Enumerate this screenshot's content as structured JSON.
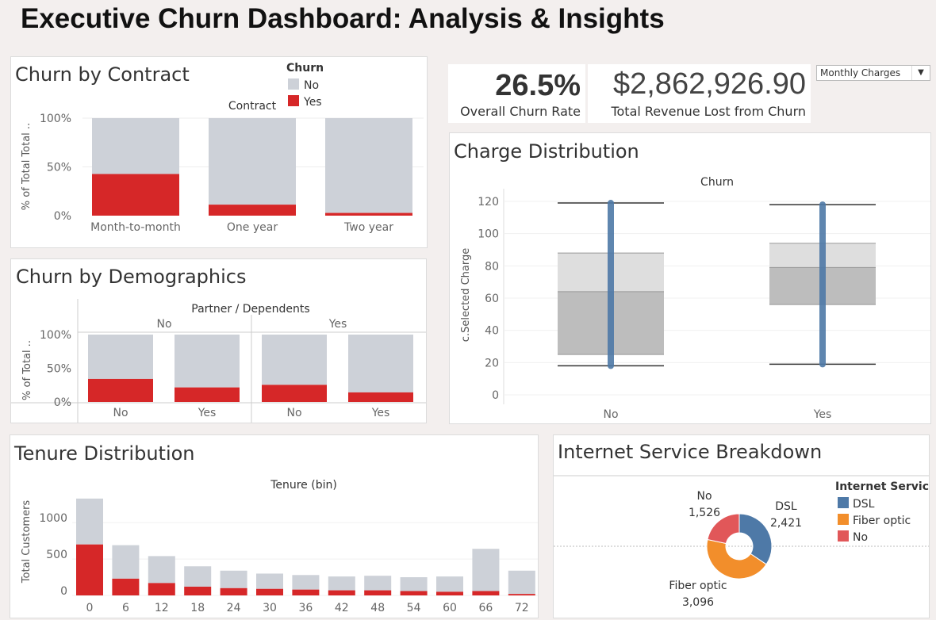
{
  "dashboard": {
    "title": "Executive Churn Dashboard: Analysis & Insights",
    "kpi_rate_value": "26.5%",
    "kpi_rate_label": "Overall Churn Rate",
    "kpi_revenue_value": "$2,862,926.90",
    "kpi_revenue_label": "Total Revenue Lost from Churn",
    "dropdown_value": "Monthly Charges"
  },
  "colors": {
    "no": "#cdd1d8",
    "yes": "#d62728",
    "box_dark": "#bdbdbd",
    "box_light": "#dedede",
    "strip": "#4e79a7",
    "dsl": "#4e79a7",
    "fiber": "#f28e2b",
    "none": "#e15759"
  },
  "chart_data": [
    {
      "id": "contract",
      "type": "bar",
      "title": "Churn by Contract",
      "header": "Contract",
      "ylabel": "% of Total Total ..",
      "legend_title": "Churn",
      "legend": [
        "No",
        "Yes"
      ],
      "categories": [
        "Month-to-month",
        "One year",
        "Two year"
      ],
      "yticks": [
        "100%",
        "50%",
        "0%"
      ],
      "ylim": [
        0,
        1
      ],
      "series": [
        {
          "name": "No",
          "values": [
            0.573,
            0.887,
            0.972
          ]
        },
        {
          "name": "Yes",
          "values": [
            0.427,
            0.113,
            0.028
          ]
        }
      ]
    },
    {
      "id": "demographics",
      "type": "bar",
      "title": "Churn by Demographics",
      "header": "Partner  /  Dependents",
      "ylabel": "% of Total ..",
      "groups": [
        "No",
        "Yes"
      ],
      "categories": [
        "No",
        "Yes",
        "No",
        "Yes"
      ],
      "yticks": [
        "100%",
        "50%",
        "0%"
      ],
      "ylim": [
        0,
        1
      ],
      "series": [
        {
          "name": "No",
          "values": [
            0.658,
            0.784,
            0.746,
            0.858
          ]
        },
        {
          "name": "Yes",
          "values": [
            0.342,
            0.216,
            0.254,
            0.142
          ]
        }
      ]
    },
    {
      "id": "charges",
      "type": "box",
      "title": "Charge Distribution",
      "header": "Churn",
      "ylabel": "c.Selected Charge",
      "categories": [
        "No",
        "Yes"
      ],
      "yticks": [
        0,
        20,
        40,
        60,
        80,
        100,
        120
      ],
      "ylim": [
        0,
        120
      ],
      "boxes": [
        {
          "name": "No",
          "min": 18,
          "q1": 25,
          "median": 64,
          "q3": 88,
          "max": 119
        },
        {
          "name": "Yes",
          "min": 19,
          "q1": 56,
          "median": 79,
          "q3": 94,
          "max": 118
        }
      ]
    },
    {
      "id": "tenure",
      "type": "bar",
      "title": "Tenure Distribution",
      "header": "Tenure (bin)",
      "ylabel": "Total Customers",
      "categories": [
        "0",
        "6",
        "12",
        "18",
        "24",
        "30",
        "36",
        "42",
        "48",
        "54",
        "60",
        "66",
        "72"
      ],
      "yticks": [
        0,
        500,
        1000
      ],
      "ylim": [
        0,
        1350
      ],
      "series": [
        {
          "name": "No",
          "values": [
            630,
            460,
            370,
            280,
            240,
            210,
            200,
            190,
            200,
            190,
            210,
            580,
            320
          ]
        },
        {
          "name": "Yes",
          "values": [
            700,
            230,
            170,
            120,
            100,
            90,
            80,
            70,
            70,
            60,
            50,
            60,
            20
          ]
        }
      ]
    },
    {
      "id": "internet",
      "type": "pie",
      "title": "Internet Service Breakdown",
      "legend_title": "Internet Service",
      "labels": [
        "DSL",
        "Fiber optic",
        "No"
      ],
      "values": [
        2421,
        3096,
        1526
      ],
      "value_labels": [
        "2,421",
        "3,096",
        "1,526"
      ]
    }
  ]
}
